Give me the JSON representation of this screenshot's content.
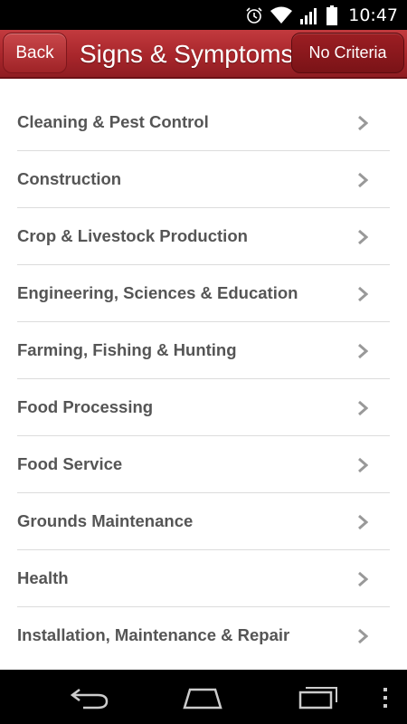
{
  "status_bar": {
    "time": "10:47"
  },
  "action_bar": {
    "back_label": "Back",
    "title": "Signs & Symptoms",
    "criteria_label": "No Criteria"
  },
  "list": {
    "items": [
      {
        "label": "Cleaning & Pest Control"
      },
      {
        "label": "Construction"
      },
      {
        "label": "Crop & Livestock Production"
      },
      {
        "label": "Engineering, Sciences & Education"
      },
      {
        "label": "Farming, Fishing & Hunting"
      },
      {
        "label": "Food Processing"
      },
      {
        "label": "Food Service"
      },
      {
        "label": "Grounds Maintenance"
      },
      {
        "label": "Health"
      },
      {
        "label": "Installation, Maintenance & Repair"
      }
    ]
  },
  "colors": {
    "action_bar": "#a8262b",
    "item_text": "#555555",
    "chevron": "#999999"
  },
  "icons": {
    "status": [
      "alarm-icon",
      "wifi-icon",
      "signal-icon",
      "battery-icon"
    ],
    "list_item": "chevron-right-icon",
    "nav": [
      "back-nav-icon",
      "home-nav-icon",
      "recents-nav-icon",
      "overflow-menu-icon"
    ]
  }
}
